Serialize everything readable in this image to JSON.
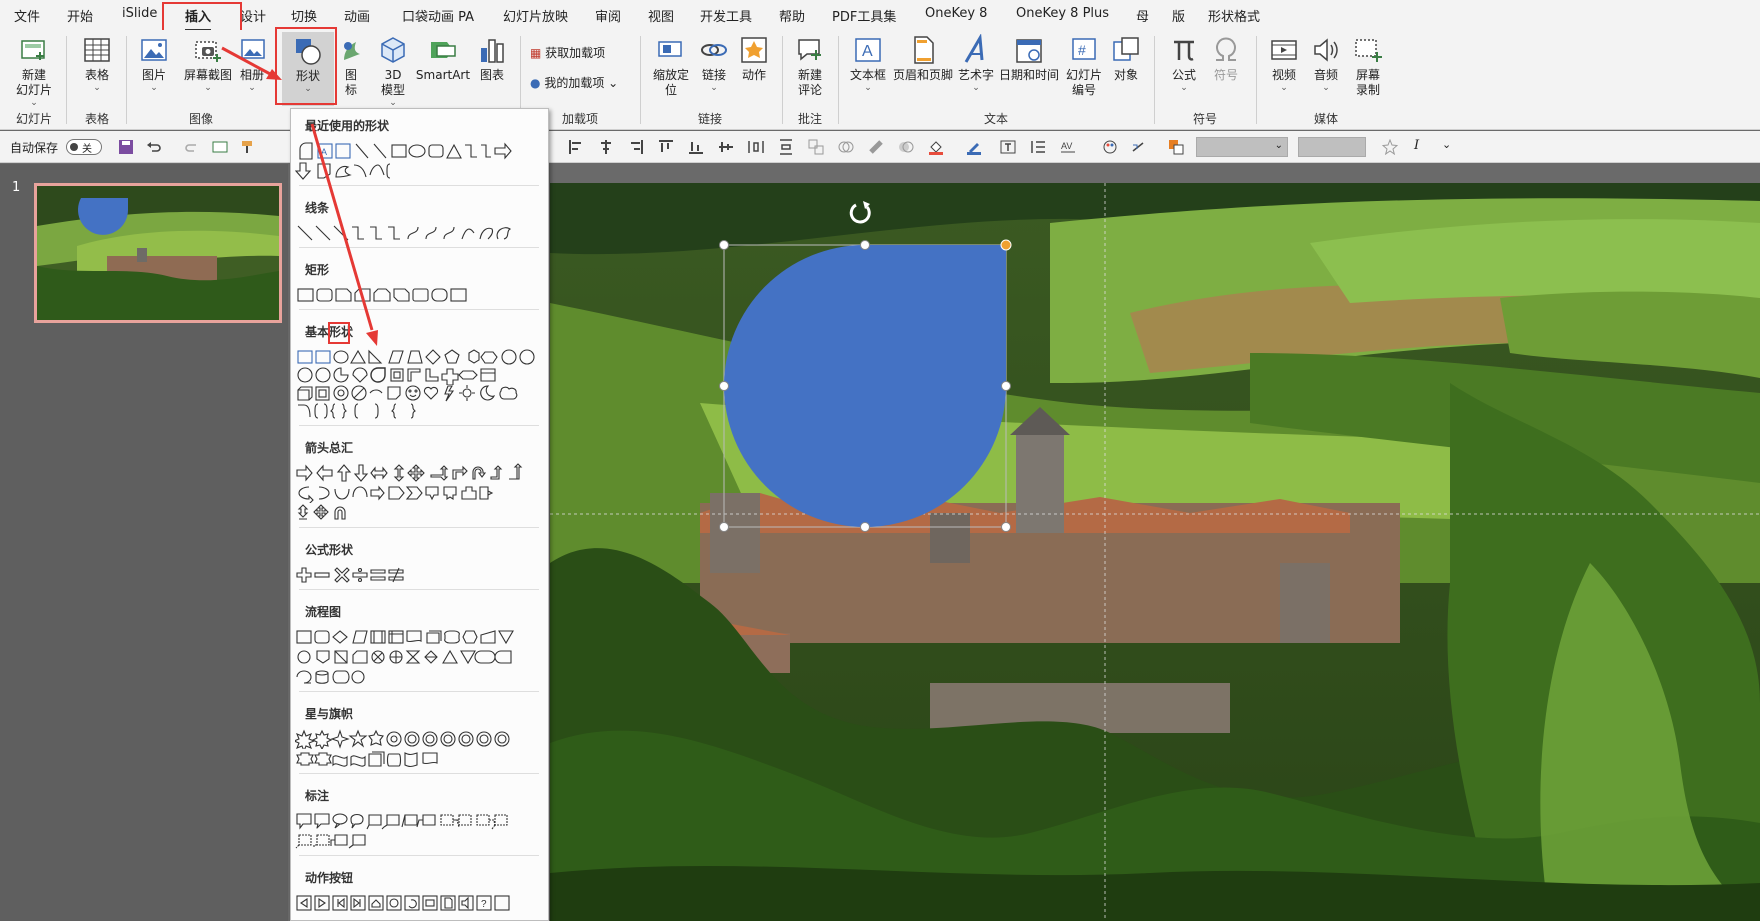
{
  "menu": {
    "items": [
      "文件",
      "开始",
      "iSlide",
      "插入",
      "设计",
      "切换",
      "动画",
      "口袋动画 PA",
      "幻灯片放映",
      "审阅",
      "视图",
      "开发工具",
      "帮助",
      "PDF工具集",
      "OneKey 8",
      "OneKey 8 Plus",
      "母",
      "版",
      "形状格式"
    ],
    "active": "插入"
  },
  "ribbon": {
    "new_slide": "新建\n幻灯片",
    "table": "表格",
    "picture": "图片",
    "screenshot": "屏幕截图",
    "album": "相册",
    "shapes": "形状",
    "icons": "图\n标",
    "model3d": "3D\n模型",
    "smartart": "SmartArt",
    "chart": "图表",
    "get_addins": "获取加载项",
    "my_addins": "我的加载项",
    "zoom": "缩放定\n位",
    "link": "链接",
    "action": "动作",
    "new_comment": "新建\n评论",
    "textbox": "文本框",
    "header_footer": "页眉和页脚",
    "wordart": "艺术字",
    "datetime": "日期和时间",
    "slide_number": "幻灯片\n编号",
    "object": "对象",
    "equation": "公式",
    "symbol": "符号",
    "video": "视频",
    "audio": "音频",
    "screen_record": "屏幕\n录制",
    "groups": {
      "slides": "幻灯片",
      "tables": "表格",
      "images": "图像",
      "addins": "加载项",
      "links": "链接",
      "comments": "批注",
      "text": "文本",
      "symbols": "符号",
      "media": "媒体"
    }
  },
  "qat": {
    "autosave": "自动保存",
    "toggle": "关"
  },
  "slides": {
    "number": "1"
  },
  "shapes_menu": {
    "sections": [
      "最近使用的形状",
      "线条",
      "矩形",
      "基本形状",
      "箭头总汇",
      "公式形状",
      "流程图",
      "星与旗帜",
      "标注",
      "动作按钮"
    ]
  },
  "colors": {
    "accent": "#e53935",
    "shape_fill": "#4472c4",
    "ribbon_bg": "#f3f3f3"
  }
}
